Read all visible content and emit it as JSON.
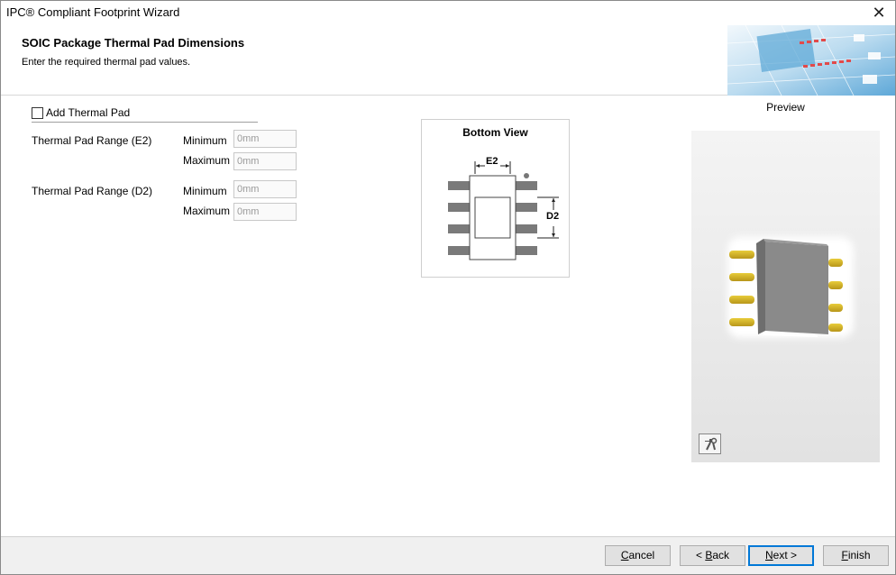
{
  "window": {
    "title": "IPC® Compliant Footprint Wizard",
    "close_glyph": "✕"
  },
  "header": {
    "title": "SOIC Package Thermal Pad Dimensions",
    "subtitle": "Enter the required thermal pad values."
  },
  "form": {
    "add_thermal_pad_label": "Add Thermal Pad",
    "add_thermal_pad_checked": false,
    "e2": {
      "label": "Thermal Pad Range (E2)",
      "min_label": "Minimum",
      "max_label": "Maximum",
      "min_value": "0mm",
      "max_value": "0mm"
    },
    "d2": {
      "label": "Thermal Pad Range (D2)",
      "min_label": "Minimum",
      "max_label": "Maximum",
      "min_value": "0mm",
      "max_value": "0mm"
    }
  },
  "bottom_view": {
    "title": "Bottom View",
    "e2_label": "E2",
    "d2_label": "D2"
  },
  "preview": {
    "label": "Preview",
    "tool_icon": "hammer-wrench-icon"
  },
  "footer": {
    "cancel": {
      "pre": "",
      "key": "C",
      "post": "ancel"
    },
    "back": {
      "pre": "< ",
      "key": "B",
      "post": "ack"
    },
    "next": {
      "pre": "",
      "key": "N",
      "post": "ext >"
    },
    "finish": {
      "pre": "",
      "key": "F",
      "post": "inish"
    }
  },
  "colors": {
    "pad_gray": "#7a7a7a",
    "lead_gold": "#d4b320",
    "body_gray": "#8a8a8a",
    "primary_border": "#0078d7"
  }
}
